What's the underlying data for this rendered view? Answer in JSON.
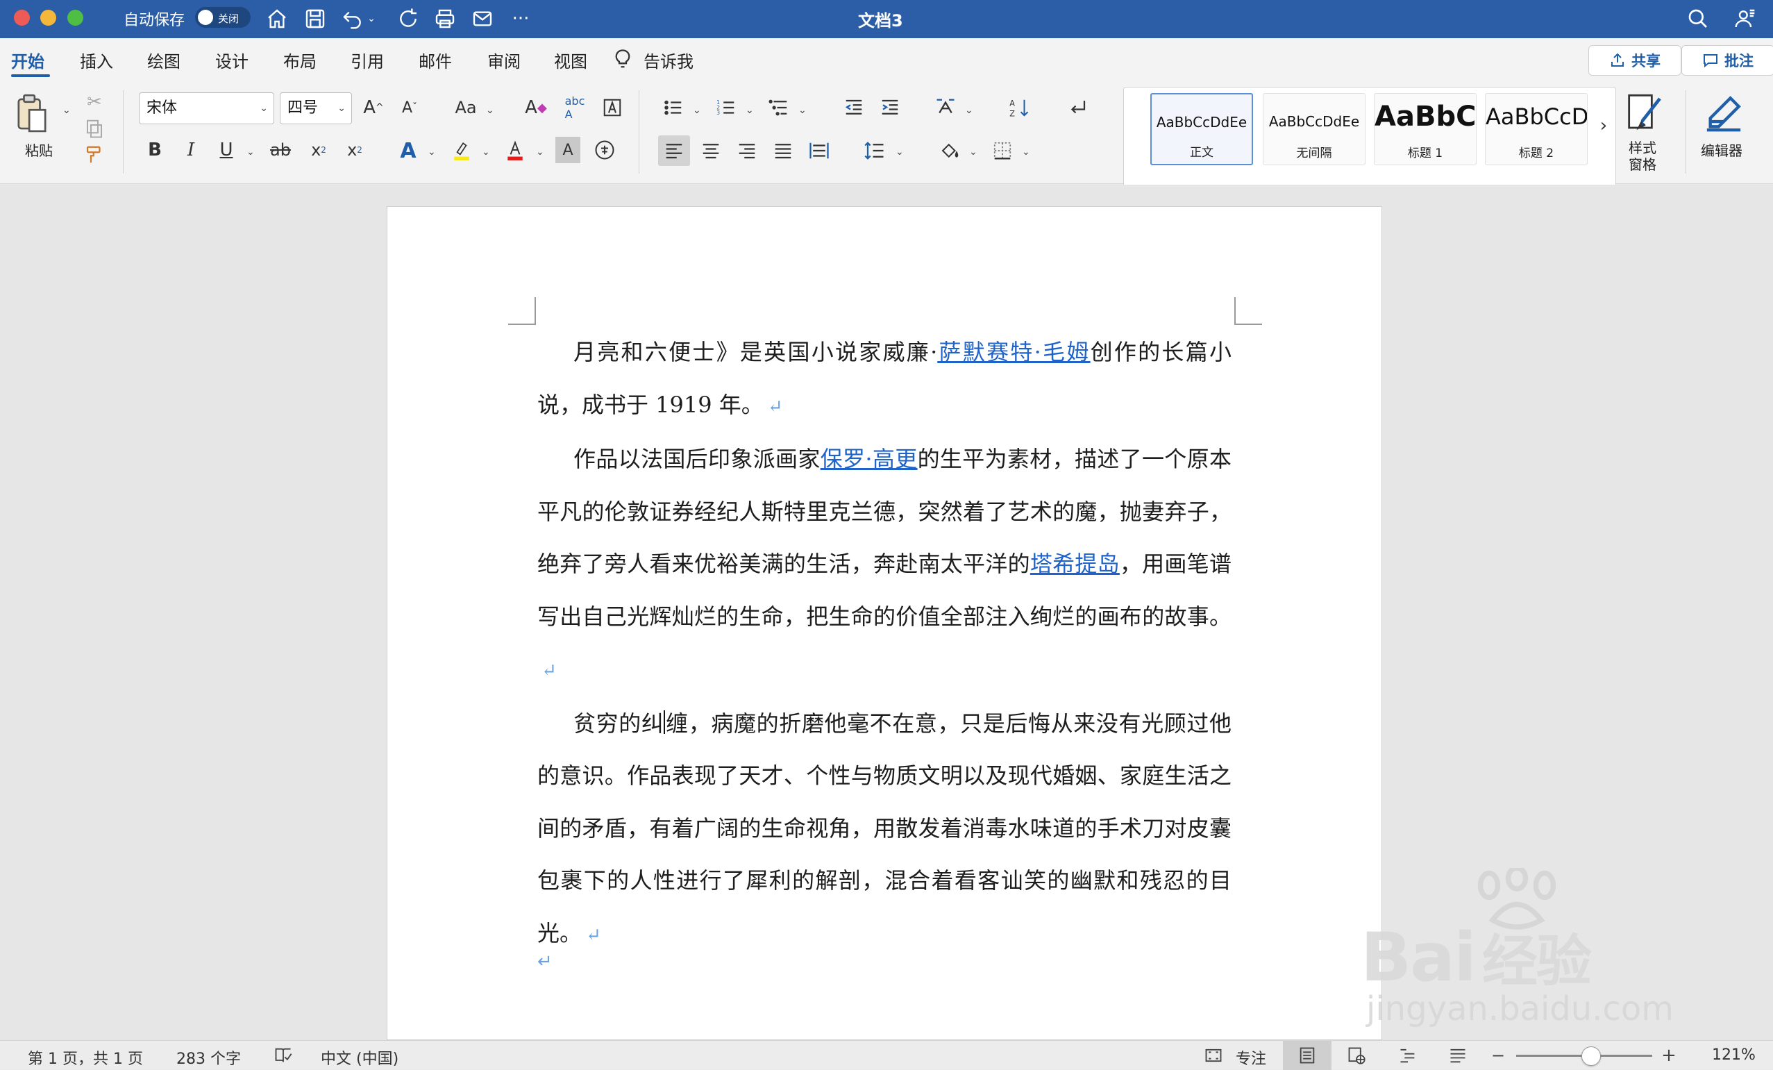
{
  "window": {
    "title": "文档3",
    "autosave_label": "自动保存",
    "autosave_state": "关闭"
  },
  "ribbon": {
    "tabs": [
      "开始",
      "插入",
      "绘图",
      "设计",
      "布局",
      "引用",
      "邮件",
      "审阅",
      "视图"
    ],
    "tell_me": "告诉我",
    "share": "共享",
    "comments": "批注",
    "paste_label": "粘贴",
    "font_name": "宋体",
    "font_size": "四号",
    "styles": [
      {
        "preview": "AaBbCcDdEe",
        "name": "正文"
      },
      {
        "preview": "AaBbCcDdEe",
        "name": "无间隔"
      },
      {
        "preview": "AaBbC",
        "name": "标题 1"
      },
      {
        "preview": "AaBbCcD",
        "name": "标题 2"
      }
    ],
    "styles_pane_label": "样式\n窗格",
    "editor_label": "编辑器"
  },
  "document": {
    "p1_a": "月亮和六便士》是英国小说家威廉·",
    "p1_link": "萨默赛特·毛姆",
    "p1_b": "创作的长篇小说，成书于 1919 年。",
    "p2_a": "作品以法国后印象派画家",
    "p2_link1": "保罗·高更",
    "p2_b": "的生平为素材，描述了一个原本平凡的伦敦证券经纪人斯特里克兰德，突然着了艺术的魔，抛妻弃子，绝弃了旁人看来优裕美满的生活，奔赴南太平洋的",
    "p2_link2": "塔希提岛",
    "p2_c": "，用画笔谱写出自己光辉灿烂的生命，把生命的价值全部注入绚烂的画布的故事。",
    "p3_a": "贫穷的纠",
    "p3_b": "缠，病魔的折磨他毫不在意，只是后悔从来没有光顾过他的意识。作品表现了天才、个性与物质文明以及现代婚姻、家庭生活之间的矛盾，有着广阔的生命视角，用散发着消毒水味道的手术刀对皮囊包裹下的人性进行了犀利的解剖，混合着看客讪笑的幽默和残忍的目光。",
    "pilcrow": "↵"
  },
  "status": {
    "page": "第 1 页，共 1 页",
    "words": "283 个字",
    "language": "中文 (中国)",
    "focus": "专注",
    "zoom": "121%",
    "zoom_fraction": 0.55
  },
  "watermark": {
    "text1": "Bai",
    "text1b": "经验",
    "text2": "jingyan.baidu.com"
  }
}
